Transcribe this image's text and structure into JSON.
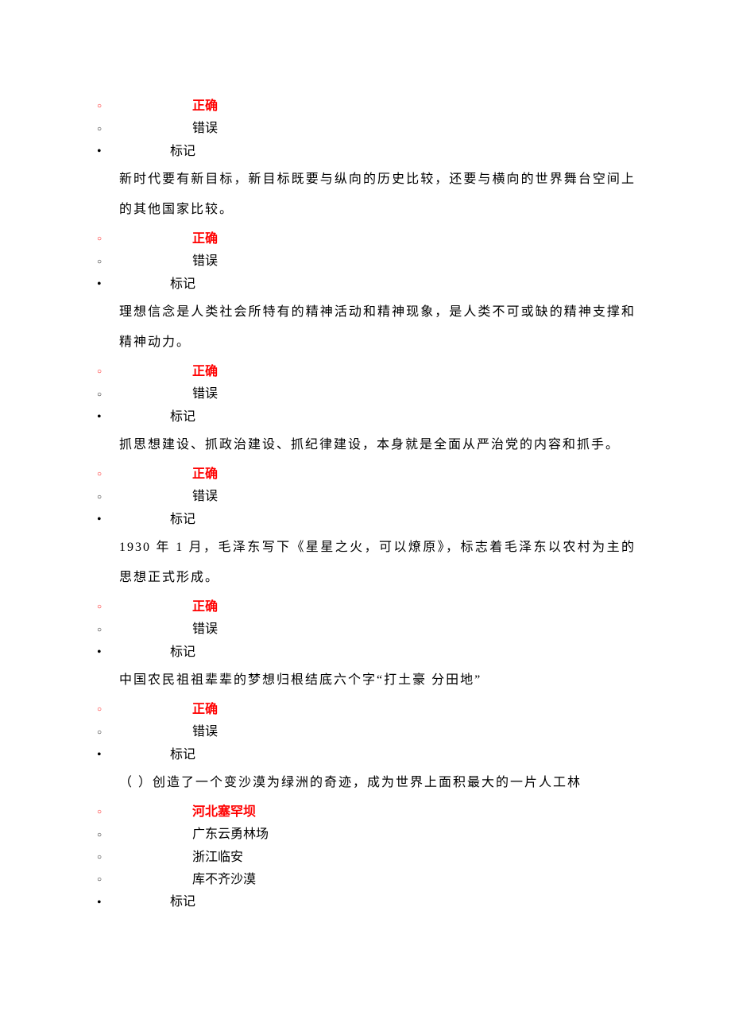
{
  "labels": {
    "correct": "正确",
    "wrong": "错误",
    "mark": "标记"
  },
  "blocks": [
    {
      "type": "tf",
      "answer": "correct",
      "question": "新时代要有新目标，新目标既要与纵向的历史比较，还要与横向的世界舞台空间上的其他国家比较。"
    },
    {
      "type": "tf",
      "answer": "correct",
      "question": "理想信念是人类社会所特有的精神活动和精神现象，是人类不可或缺的精神支撑和精神动力。"
    },
    {
      "type": "tf",
      "answer": "correct",
      "question": "抓思想建设、抓政治建设、抓纪律建设，本身就是全面从严治党的内容和抓手。"
    },
    {
      "type": "tf",
      "answer": "correct",
      "question": "1930 年 1 月，毛泽东写下《星星之火，可以燎原》，标志着毛泽东以农村为主的思想正式形成。"
    },
    {
      "type": "tf",
      "answer": "correct",
      "question": "中国农民祖祖辈辈的梦想归根结底六个字“打土豪  分田地”"
    },
    {
      "type": "mc",
      "answerIndex": 0,
      "options": [
        "河北塞罕坝",
        "广东云勇林场",
        "浙江临安",
        "库不齐沙漠"
      ],
      "question": "（  ）创造了一个变沙漠为绿洲的奇迹，成为世界上面积最大的一片人工林"
    }
  ]
}
